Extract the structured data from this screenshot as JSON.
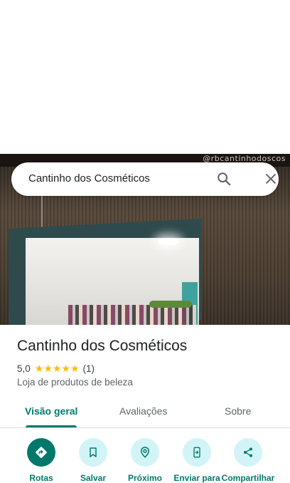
{
  "search": {
    "query": "Cantinho dos Cosméticos",
    "search_icon": "search-icon",
    "close_icon": "close-icon"
  },
  "photo": {
    "banner_text": "@rbcantinhodoscos"
  },
  "place": {
    "name": "Cantinho dos Cosméticos",
    "rating": "5,0",
    "stars": "★★★★★",
    "review_count": "(1)",
    "category": "Loja de produtos de beleza"
  },
  "tabs": [
    {
      "label": "Visão geral",
      "active": true
    },
    {
      "label": "Avaliações",
      "active": false
    },
    {
      "label": "Sobre",
      "active": false
    }
  ],
  "actions": [
    {
      "label": "Rotas",
      "icon": "directions-icon"
    },
    {
      "label": "Salvar",
      "icon": "bookmark-icon"
    },
    {
      "label": "Próximo",
      "icon": "nearby-icon"
    },
    {
      "label": "Enviar para",
      "icon": "send-to-phone-icon"
    },
    {
      "label": "Compartilhar",
      "icon": "share-icon"
    }
  ],
  "colors": {
    "accent": "#00796b",
    "action_bg": "#d2f4f7",
    "star": "#fbbc04"
  }
}
